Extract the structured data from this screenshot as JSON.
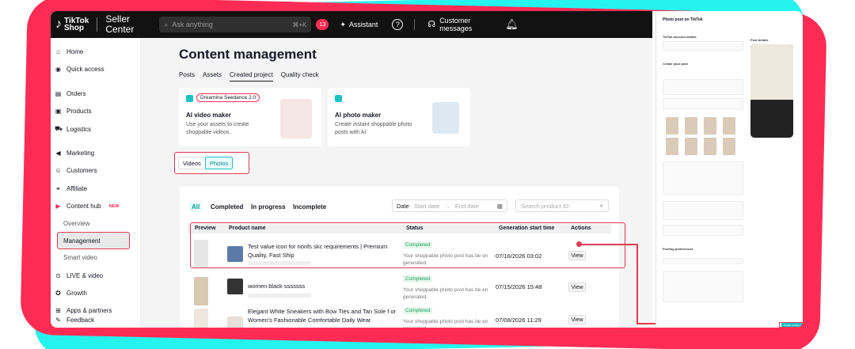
{
  "topbar": {
    "brand_line1": "TikTok",
    "brand_line2": "Shop",
    "app_line1": "Seller",
    "app_line2": "Center",
    "search_placeholder": "Ask anything",
    "search_shortcut": "⌘+K",
    "notif_count": "13",
    "assistant_label": "Assistant",
    "customer_line1": "Customer",
    "customer_line2": "messages"
  },
  "sidebar": {
    "home": "Home",
    "quick_access": "Quick access",
    "orders": "Orders",
    "products": "Products",
    "logistics": "Logistics",
    "marketing": "Marketing",
    "customers": "Customers",
    "affiliate": "Affiliate",
    "content_hub": "Content hub",
    "content_hub_tag": "NEW",
    "overview": "Overview",
    "management": "Management",
    "smart_video": "Smart video",
    "live_video": "LIVE & video",
    "growth": "Growth",
    "apps_partners": "Apps & partners",
    "feedback": "Feedback"
  },
  "main": {
    "title": "Content management",
    "tabs": [
      "Posts",
      "Assets",
      "Created project",
      "Quality check"
    ],
    "card_video": {
      "pill": "Dreamina Seedance 2.0",
      "title": "AI video maker",
      "desc": "Use your assets to create shoppable videos."
    },
    "card_photo": {
      "title": "AI photo maker",
      "desc": "Create instant shoppable photo posts with AI"
    },
    "toggle": {
      "videos": "Videos",
      "photos": "Photos"
    },
    "filters": [
      "All",
      "Completed",
      "In progress",
      "Incomplete"
    ],
    "date_label": "Date",
    "date_start": "Start date",
    "date_end": "End date",
    "search_product": "Search product ID",
    "columns": [
      "Preview",
      "Product name",
      "Status",
      "Generation start time",
      "Actions"
    ],
    "rows": [
      {
        "name": "Test value icon for nonfs skc requirements | Premium Quality, Fast Ship",
        "status": "Completed",
        "status_desc": "Your shoppable photo post has be en generated.",
        "time": "07/16/2026 03:02",
        "action": "View"
      },
      {
        "name": "women black sssssss",
        "status": "Completed",
        "status_desc": "Your shoppable photo post has be en generated.",
        "time": "07/15/2026 15:48",
        "action": "View"
      },
      {
        "name": "Elegant White Sneakers with Bow Ties and Tan Sole f or Women's Fashionable Comfortable Daily Wear",
        "status": "Completed",
        "status_desc": "Your shoppable photo post has be en generated.",
        "time": "07/08/2026 11:29",
        "action": "View"
      }
    ]
  },
  "right_panel": {
    "header": "Photo post on TikTok",
    "account_details": "TikTok account details",
    "create_post": "Create your post",
    "post_details": "Post details",
    "posting_prefs": "Posting preferences",
    "submit": "Create content"
  },
  "colors": {
    "accent": "#1cc2c4",
    "highlight": "#e03c4f",
    "cyan": "#25f4ee",
    "red": "#fe2c55"
  }
}
